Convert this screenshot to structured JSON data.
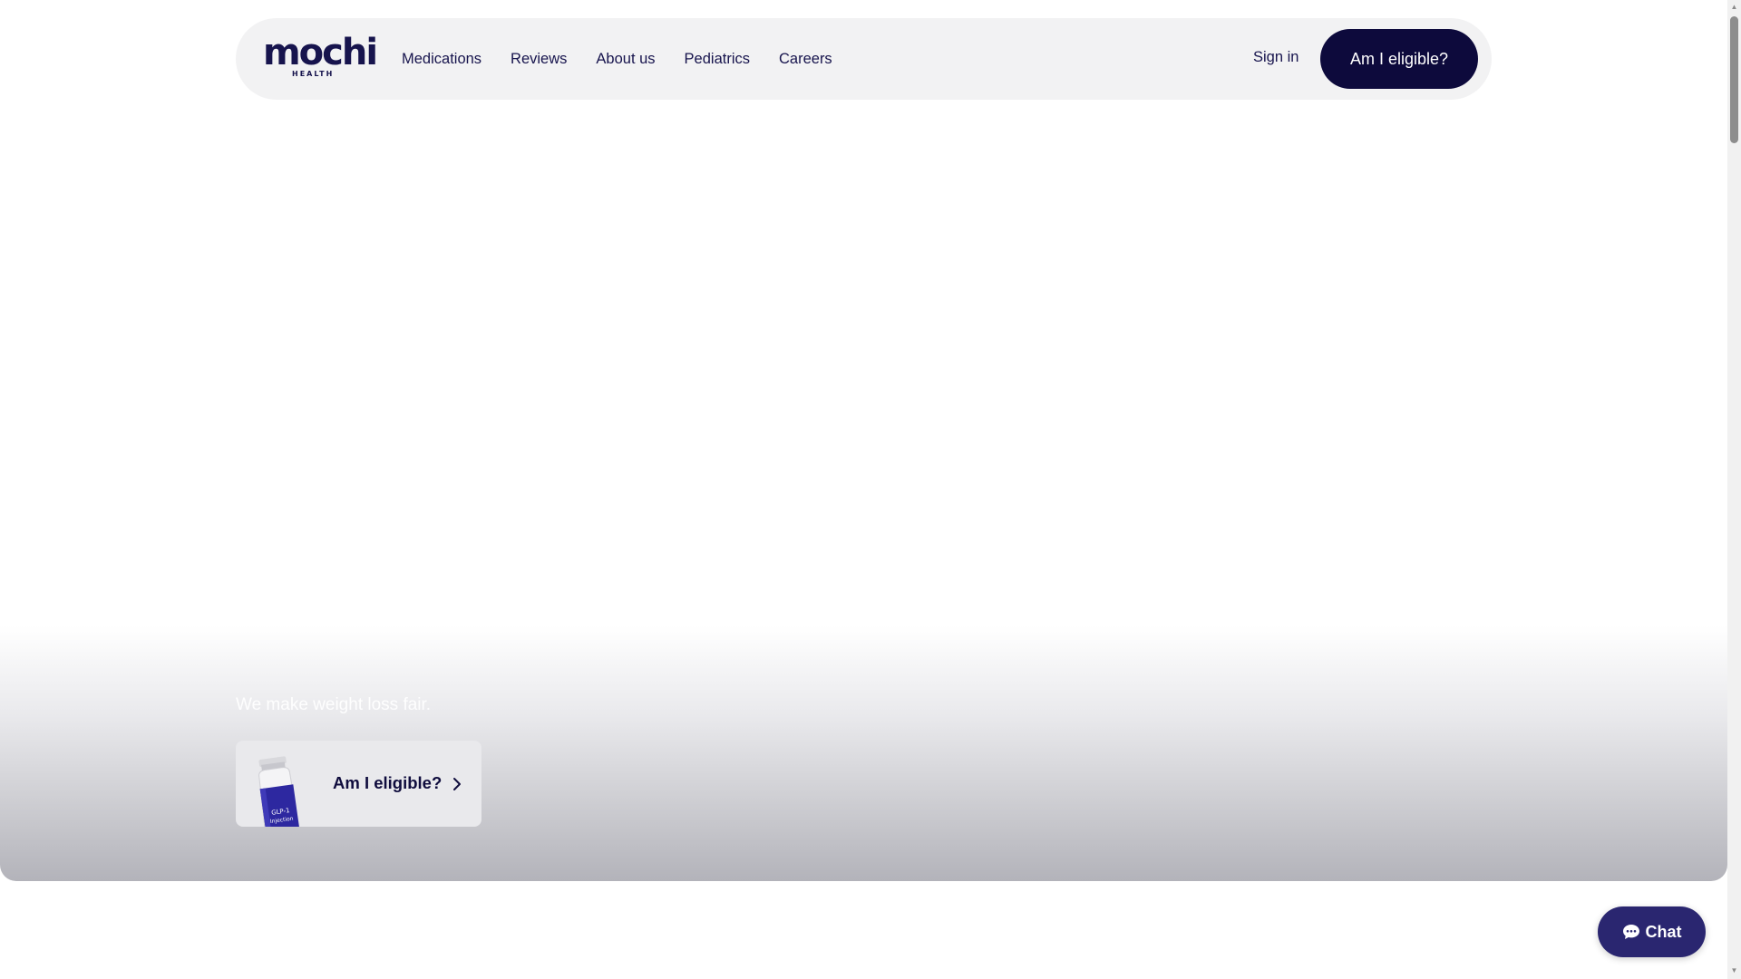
{
  "brand": {
    "name": "mochi",
    "subtitle": "HEALTH"
  },
  "nav": {
    "links": [
      {
        "label": "Medications"
      },
      {
        "label": "Reviews"
      },
      {
        "label": "About us"
      },
      {
        "label": "Pediatrics"
      },
      {
        "label": "Careers"
      }
    ],
    "sign_in": "Sign in",
    "cta": "Am I eligible?"
  },
  "hero": {
    "tagline": "We make weight loss fair.",
    "cta_card": {
      "label": "Am I eligible?",
      "vial_label_line1": "GLP-1",
      "vial_label_line2": "Injection"
    }
  },
  "chat": {
    "label": "Chat",
    "icon": "speech-bubble-icon"
  },
  "colors": {
    "brand_navy": "#0d0a3c",
    "chat_purple": "#2a2670",
    "nav_background": "#f2f2f3"
  }
}
